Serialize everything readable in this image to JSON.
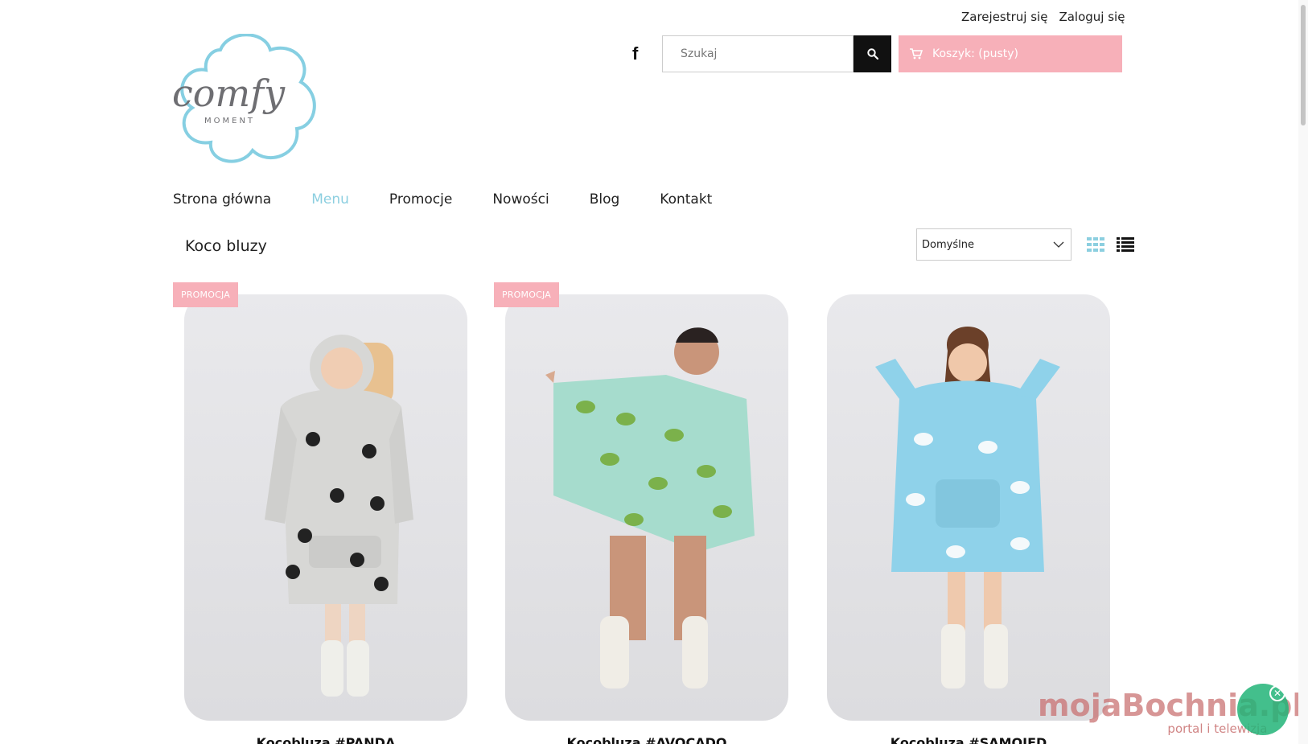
{
  "header": {
    "register_label": "Zarejestruj się",
    "login_label": "Zaloguj się",
    "logo_text": "comfy",
    "logo_subtext": "MOMENT",
    "search_placeholder": "Szukaj",
    "cart_label": "Koszyk: (pusty)"
  },
  "nav": {
    "items": [
      {
        "label": "Strona główna"
      },
      {
        "label": "Menu"
      },
      {
        "label": "Promocje"
      },
      {
        "label": "Nowości"
      },
      {
        "label": "Blog"
      },
      {
        "label": "Kontakt"
      }
    ],
    "active_index": 1
  },
  "category": {
    "title": "Koco bluzy",
    "sort_selected": "Domyślne"
  },
  "products": [
    {
      "name": "Kocobluza #PANDA",
      "badge": "PROMOCJA",
      "hoodie_color": "#d7d7d5",
      "pattern": "panda"
    },
    {
      "name": "Kocobluza #AVOCADO",
      "badge": "PROMOCJA",
      "hoodie_color": "#a6dccd",
      "pattern": "avocado"
    },
    {
      "name": "Kocobluza #SAMOJED",
      "badge": "",
      "hoodie_color": "#8fd2ea",
      "pattern": "dog"
    }
  ],
  "watermark": {
    "title": "mojaBochnia.pl",
    "subtitle": "portal i telewizja"
  },
  "colors": {
    "accent_pink": "#f7b0b9",
    "accent_blue": "#8ccfe0"
  }
}
